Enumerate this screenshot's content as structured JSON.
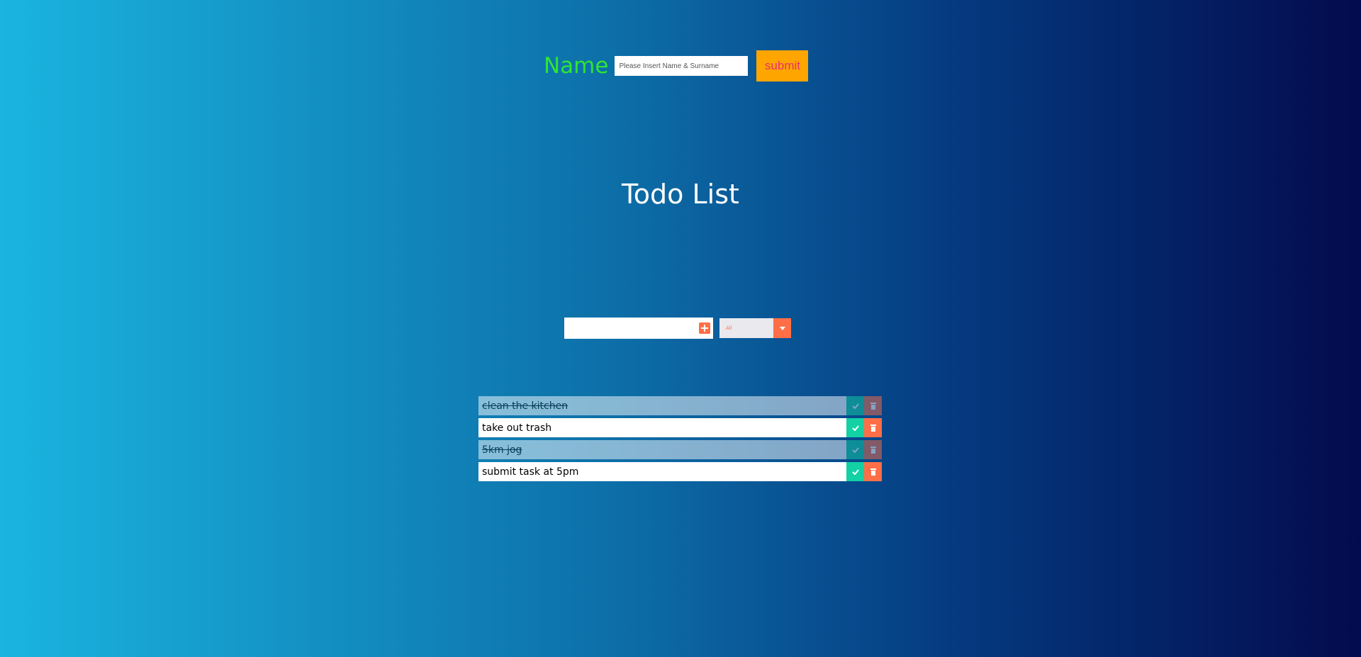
{
  "name_form": {
    "label": "Name",
    "input_placeholder": "Please Insert Name & Surname",
    "submit_label": "submit"
  },
  "title": "Todo List",
  "todo_form": {
    "input_value": "",
    "add_icon": "plus-square-icon",
    "filter_selected": "All",
    "filter_arrow_icon": "caret-down-icon"
  },
  "todos": [
    {
      "text": "clean the kitchen",
      "completed": true
    },
    {
      "text": "take out trash",
      "completed": false
    },
    {
      "text": "5km jog",
      "completed": true
    },
    {
      "text": "submit task at 5pm",
      "completed": false
    }
  ],
  "colors": {
    "name_label": "#2ee533",
    "submit_bg": "#ffa500",
    "submit_text": "#e8326b",
    "accent": "#ff6f47",
    "check": "#13d1a5",
    "gradient_start": "#1ab4e0",
    "gradient_end": "#030b4d"
  }
}
